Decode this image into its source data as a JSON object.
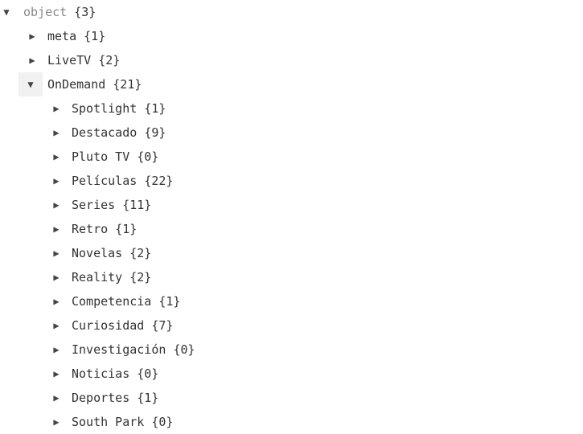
{
  "tree": {
    "root": {
      "key": "object",
      "count": "{3}",
      "expanded": true
    },
    "level1": [
      {
        "key": "meta",
        "count": "{1}",
        "expanded": false
      },
      {
        "key": "LiveTV",
        "count": "{2}",
        "expanded": false
      },
      {
        "key": "OnDemand",
        "count": "{21}",
        "expanded": true
      }
    ],
    "ondemand_children": [
      {
        "key": "Spotlight",
        "count": "{1}"
      },
      {
        "key": "Destacado",
        "count": "{9}"
      },
      {
        "key": "Pluto TV",
        "count": "{0}"
      },
      {
        "key": "Películas",
        "count": "{22}"
      },
      {
        "key": "Series",
        "count": "{11}"
      },
      {
        "key": "Retro",
        "count": "{1}"
      },
      {
        "key": "Novelas",
        "count": "{2}"
      },
      {
        "key": "Reality",
        "count": "{2}"
      },
      {
        "key": "Competencia",
        "count": "{1}"
      },
      {
        "key": "Curiosidad",
        "count": "{7}"
      },
      {
        "key": "Investigación",
        "count": "{0}"
      },
      {
        "key": "Noticias",
        "count": "{0}"
      },
      {
        "key": "Deportes",
        "count": "{1}"
      },
      {
        "key": "South Park",
        "count": "{0}"
      }
    ],
    "icons": {
      "expanded": "triangle-down-icon",
      "collapsed": "triangle-right-icon"
    }
  }
}
